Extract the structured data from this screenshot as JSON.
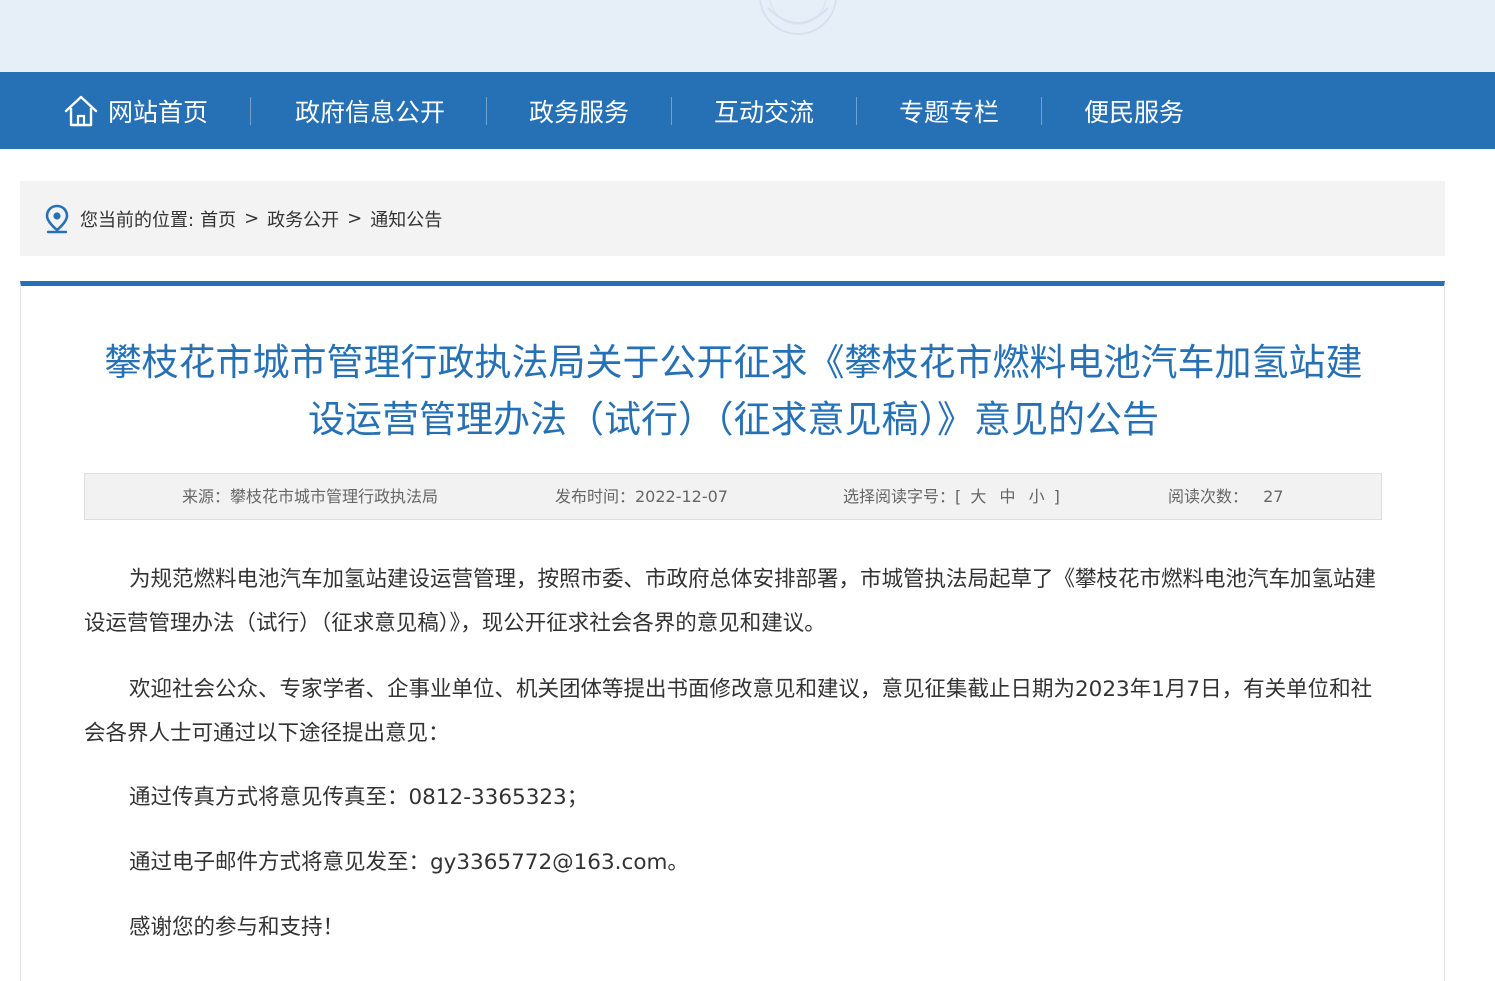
{
  "nav": {
    "home": "网站首页",
    "items": [
      "政府信息公开",
      "政务服务",
      "互动交流",
      "专题专栏",
      "便民服务"
    ]
  },
  "breadcrumb": {
    "label": "您当前的位置:",
    "items": [
      "首页",
      "政务公开",
      "通知公告"
    ],
    "separator": ">"
  },
  "article": {
    "title_line1": "攀枝花市城市管理行政执法局关于公开征求《攀枝花市燃料电池汽车加氢站建",
    "title_line2": "设运营管理办法（试行）（征求意见稿）》意见的公告",
    "meta": {
      "source": "来源：攀枝花市城市管理行政执法局",
      "publish": "发布时间：2022-12-07",
      "font_label": "选择阅读字号：[",
      "font_large": "大",
      "font_medium": "中",
      "font_small": "小",
      "font_close": "]",
      "views_label": "阅读次数：",
      "views": "27"
    },
    "paragraphs": [
      "为规范燃料电池汽车加氢站建设运营管理，按照市委、市政府总体安排部署，市城管执法局起草了《攀枝花市燃料电池汽车加氢站建设运营管理办法（试行）（征求意见稿）》，现公开征求社会各界的意见和建议。",
      "欢迎社会公众、专家学者、企事业单位、机关团体等提出书面修改意见和建议，意见征集截止日期为2023年1月7日，有关单位和社会各界人士可通过以下途径提出意见：",
      "通过传真方式将意见传真至：0812-3365323；",
      "通过电子邮件方式将意见发至：gy3365772@163.com。",
      "感谢您的参与和支持！"
    ]
  },
  "colors": {
    "nav_bg": "#2670b5",
    "title": "#2670b5",
    "banner_bg": "#e6eff7"
  }
}
